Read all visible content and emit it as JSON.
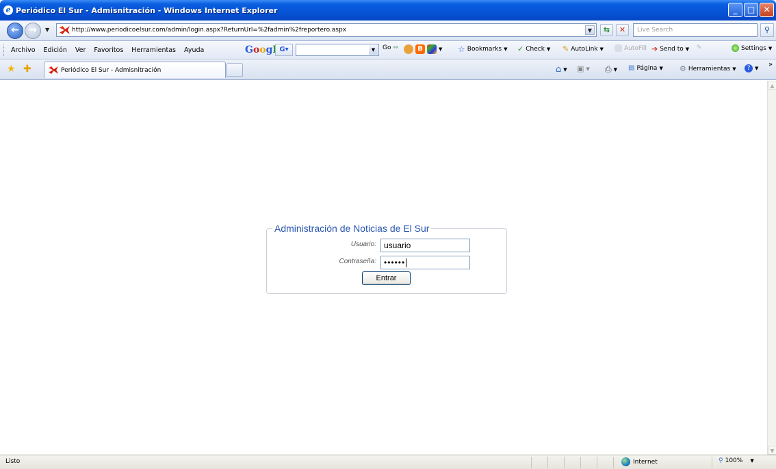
{
  "window": {
    "title": "Periódico El Sur - Admisnitración - Windows Internet Explorer",
    "icon": "ie-logo-icon",
    "controls": {
      "minimize": "_",
      "maximize": "□",
      "close": "✕"
    }
  },
  "address_bar": {
    "url": "http://www.periodicoelsur.com/admin/login.aspx?ReturnUrl=%2fadmin%2freportero.aspx",
    "search_placeholder": "Live Search",
    "refresh_icon": "refresh-icon",
    "stop_icon": "stop-icon",
    "search_icon": "magnifier-icon"
  },
  "menu": {
    "items": [
      "Archivo",
      "Edición",
      "Ver",
      "Favoritos",
      "Herramientas",
      "Ayuda"
    ]
  },
  "google_toolbar": {
    "logo": [
      "G",
      "o",
      "o",
      "g",
      "l",
      "e"
    ],
    "go_label": "Go",
    "bookmarks_label": "Bookmarks",
    "check_label": "Check",
    "autolink_label": "AutoLink",
    "autofill_label": "AutoFill",
    "sendto_label": "Send to",
    "settings_label": "Settings"
  },
  "tabs": {
    "active_label": "Periódico El Sur - Admisnitración"
  },
  "command_bar": {
    "page_label": "Página",
    "tools_label": "Herramientas"
  },
  "login": {
    "legend": "Administración de Noticias de El Sur",
    "username_label": "Usuario:",
    "username_value": "usuario",
    "password_label": "Contraseña:",
    "password_value": "••••••",
    "submit_label": "Entrar"
  },
  "status_bar": {
    "status": "Listo",
    "zone": "Internet",
    "zoom": "100%"
  },
  "colors": {
    "titlebar": "#0653d6",
    "legend_text": "#2a56b0",
    "fieldset_border": "#c9cfd9"
  }
}
